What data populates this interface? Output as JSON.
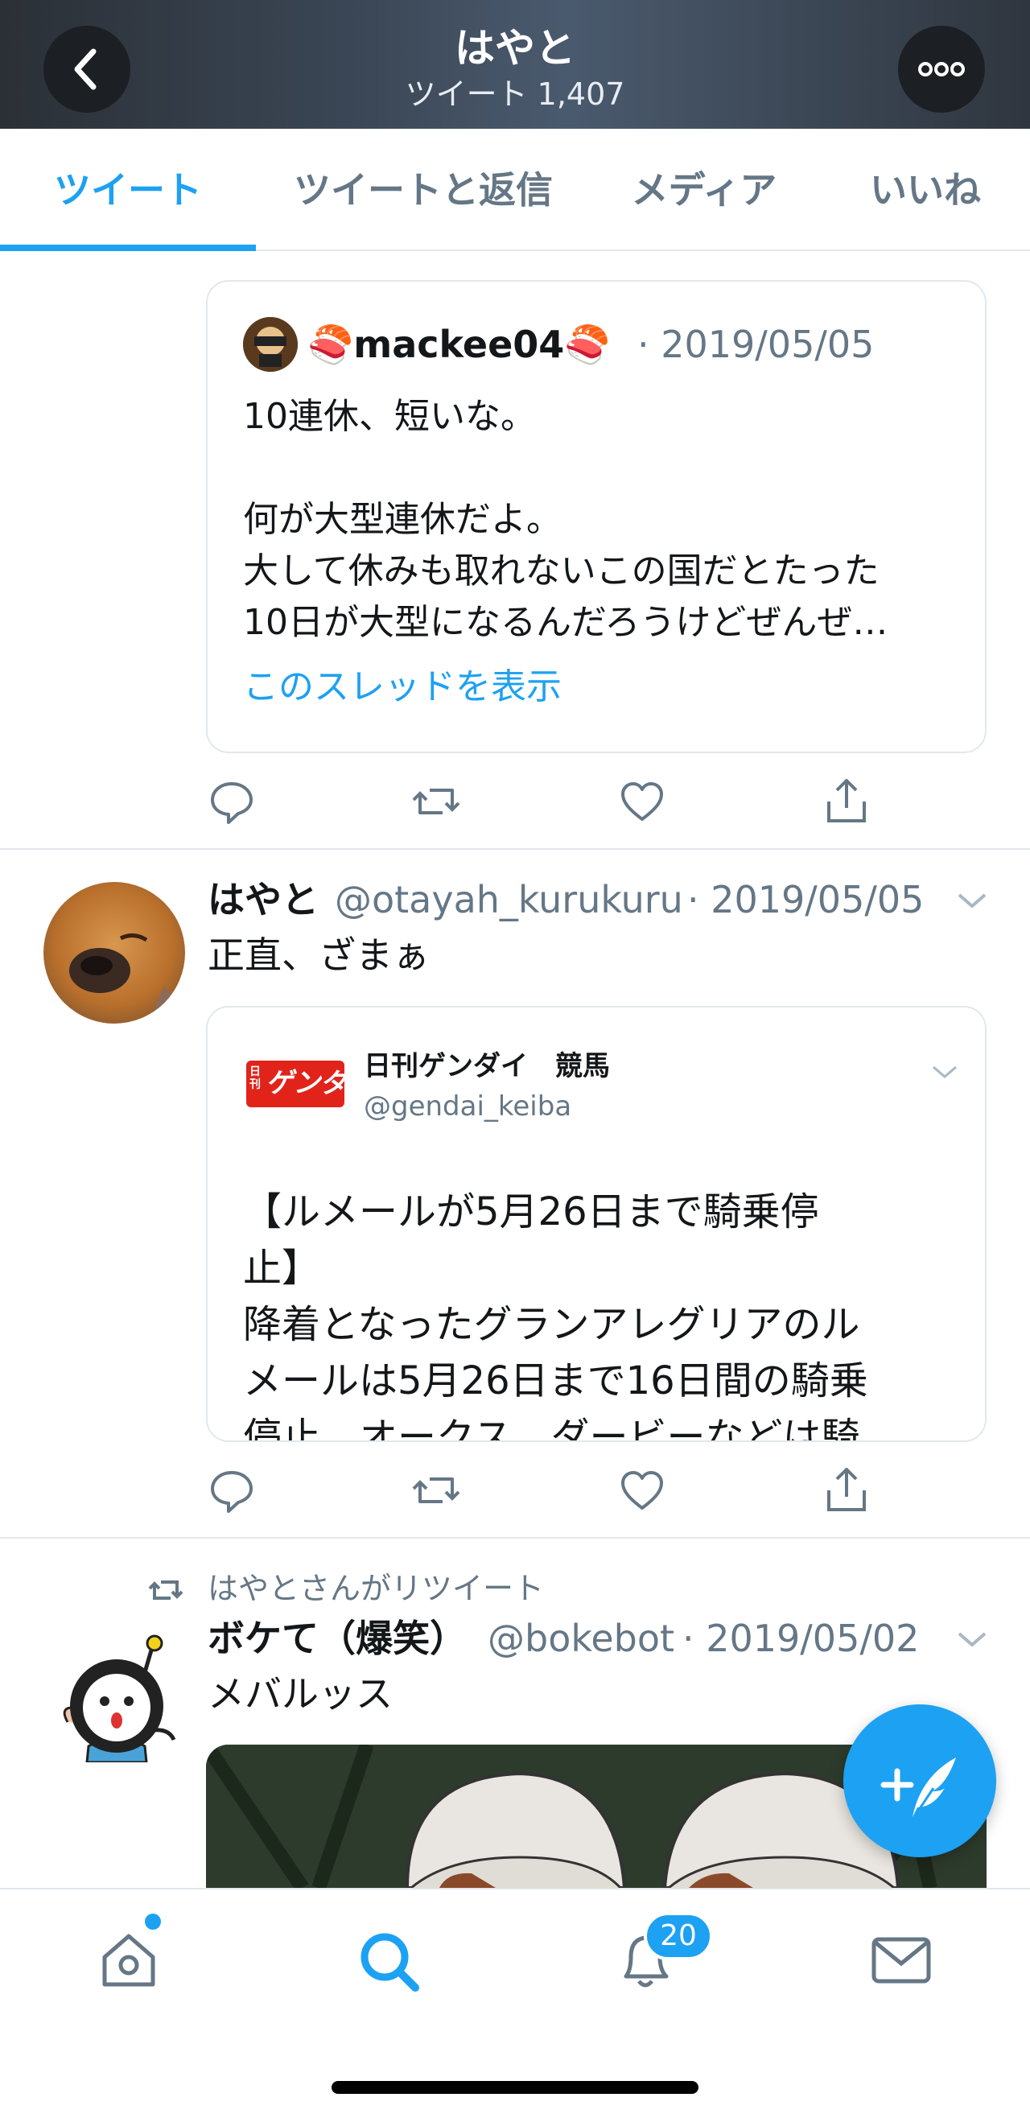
{
  "header": {
    "title": "はやと",
    "subtitle": "ツイート 1,407"
  },
  "tabs": [
    {
      "label": "ツイート",
      "active": true
    },
    {
      "label": "ツイートと返信",
      "active": false
    },
    {
      "label": "メディア",
      "active": false
    },
    {
      "label": "いいね",
      "active": false
    }
  ],
  "tweet1": {
    "quote": {
      "author": "🍣mackee04🍣",
      "date": "· 2019/05/05",
      "lines": [
        "10連休、短いな。",
        "",
        "何が大型連休だよ。",
        "大して休みも取れないこの国だとたった",
        "10日が大型になるんだろうけどぜんぜ…"
      ],
      "show_thread": "このスレッドを表示"
    }
  },
  "tweet2": {
    "name": "はやと",
    "handle": "@otayah_kurukuru",
    "date": "· 2019/05/05",
    "text": "正直、ざまぁ",
    "embed": {
      "logo_text": "ゲンダイ",
      "logo_small": "日刊",
      "account_name": "日刊ゲンダイ　競馬",
      "account_handle": "@gendai_keiba",
      "lines": [
        "【ルメールが5月26日まで騎乗停",
        "止】",
        "降着となったグランアレグリアのル",
        "メールは5月26日まで16日間の騎乗",
        "停止。オークス、ダービーなどは騎"
      ]
    }
  },
  "tweet3": {
    "retweet_context": "はやとさんがリツイート",
    "name": "ボケて（爆笑）",
    "handle": "@bokebot",
    "date": "· 2019/05/02",
    "text": "メバルッス"
  },
  "bottom_nav": {
    "notifications_badge": "20"
  },
  "colors": {
    "accent": "#1da1f2",
    "muted": "#657786",
    "border": "#e1e8ed"
  }
}
